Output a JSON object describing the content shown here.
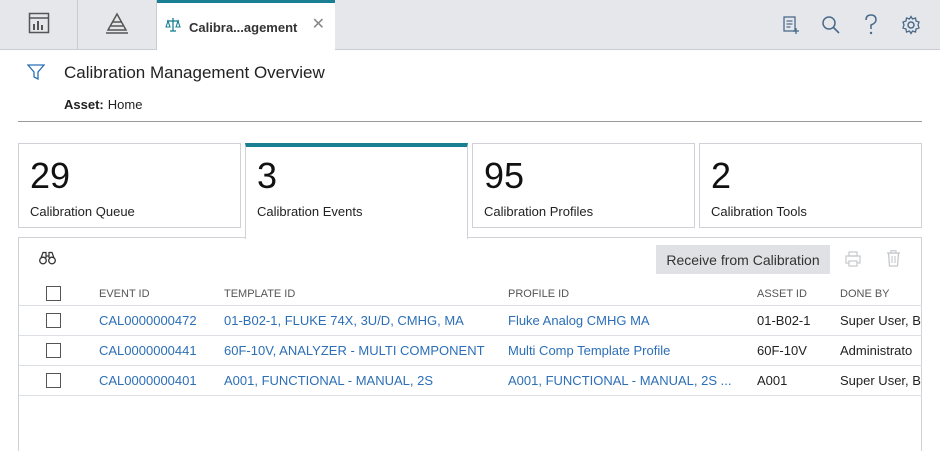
{
  "tabs": {
    "active_label": "Calibra...agement"
  },
  "header": {
    "title": "Calibration Management Overview",
    "asset_label": "Asset:",
    "asset_value": "Home"
  },
  "tiles": [
    {
      "value": "29",
      "label": "Calibration Queue"
    },
    {
      "value": "3",
      "label": "Calibration Events"
    },
    {
      "value": "95",
      "label": "Calibration Profiles"
    },
    {
      "value": "2",
      "label": "Calibration Tools"
    }
  ],
  "toolbar": {
    "receive_label": "Receive from Calibration"
  },
  "table": {
    "columns": [
      "EVENT ID",
      "TEMPLATE ID",
      "PROFILE ID",
      "ASSET ID",
      "DONE BY"
    ],
    "rows": [
      {
        "event_id": "CAL0000000472",
        "template_id": "01-B02-1, FLUKE 74X, 3U/D, CMHG, MA",
        "profile_id": "Fluke Analog CMHG MA",
        "asset_id": "01-B02-1",
        "done_by": "Super User, B"
      },
      {
        "event_id": "CAL0000000441",
        "template_id": "60F-10V, ANALYZER - MULTI COMPONENT",
        "profile_id": "Multi Comp Template Profile",
        "asset_id": "60F-10V",
        "done_by": "Administrato"
      },
      {
        "event_id": "CAL0000000401",
        "template_id": "A001, FUNCTIONAL - MANUAL, 2S",
        "profile_id": "A001, FUNCTIONAL - MANUAL, 2S ...",
        "asset_id": "A001",
        "done_by": "Super User, B"
      }
    ]
  },
  "colors": {
    "accent": "#1a7f91",
    "link": "#2c6fb7",
    "topbar": "#e5e7eb"
  }
}
